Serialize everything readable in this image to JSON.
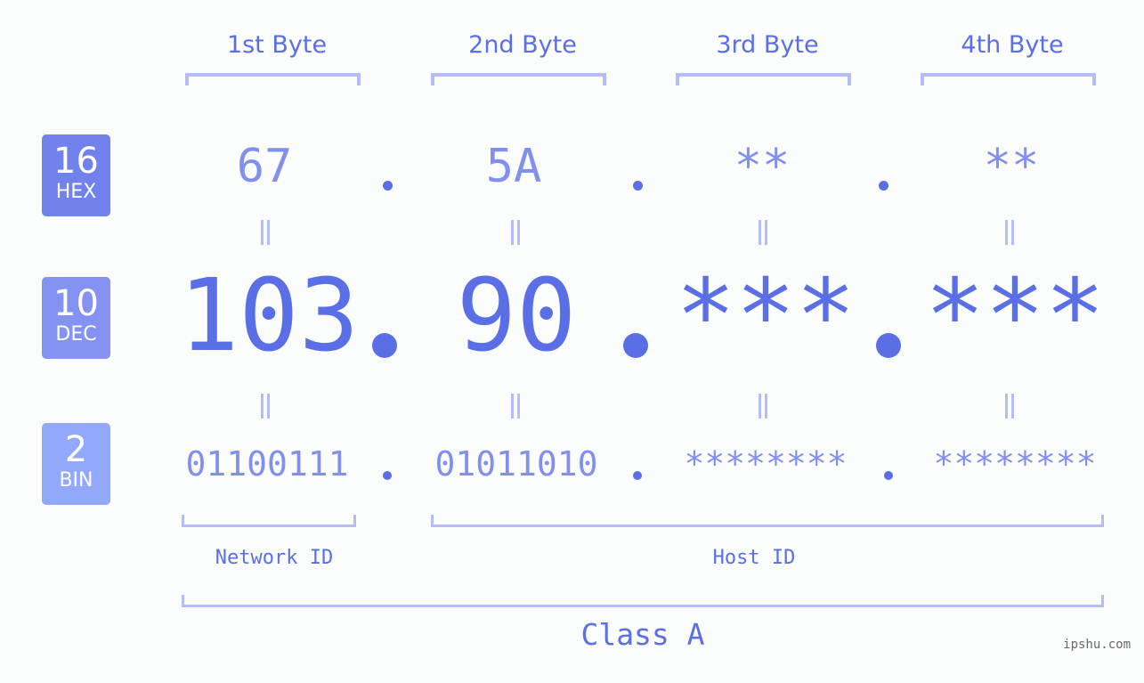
{
  "colors": {
    "hex_badge": "#7282ec",
    "dec_badge": "#8493f2",
    "bin_badge": "#92a8fa",
    "primary": "#5a6fe6",
    "secondary": "#8190ee",
    "bracket": "#b4bdf8",
    "background": "#fbfcfc"
  },
  "badges": [
    {
      "base": "16",
      "label": "HEX"
    },
    {
      "base": "10",
      "label": "DEC"
    },
    {
      "base": "2",
      "label": "BIN"
    }
  ],
  "columns": [
    "1st Byte",
    "2nd Byte",
    "3rd Byte",
    "4th Byte"
  ],
  "hex": [
    "67",
    "5A",
    "**",
    "**"
  ],
  "dec": [
    "103",
    "90",
    "***",
    "***"
  ],
  "bin": [
    "01100111",
    "01011010",
    "********",
    "********"
  ],
  "separator": ".",
  "equals_symbol": "=",
  "segments": {
    "network": "Network ID",
    "host": "Host ID",
    "class": "Class A"
  },
  "watermark": "ipshu.com"
}
